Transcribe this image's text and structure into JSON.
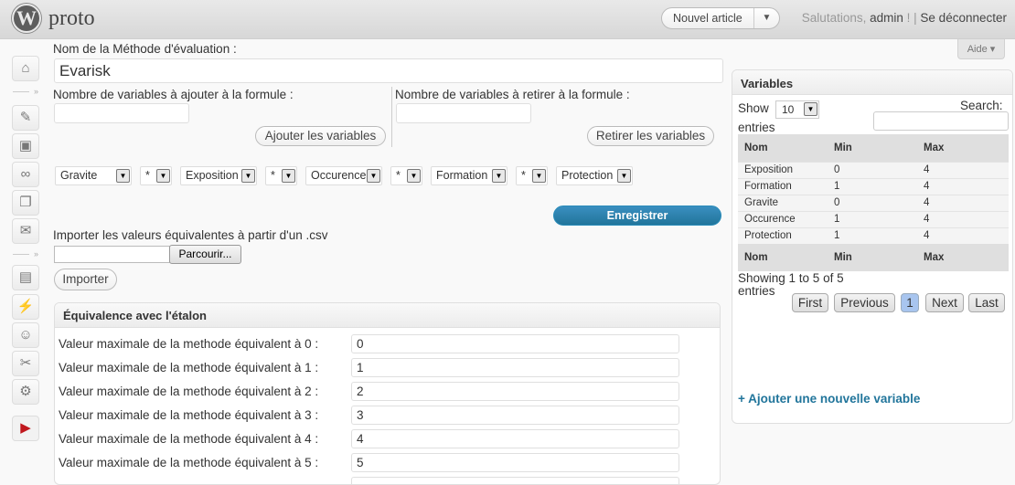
{
  "header": {
    "logo_letter": "W",
    "site_title": "proto",
    "favorite_action": "Nouvel article",
    "greeting_prefix": "Salutations,",
    "user": "admin",
    "greeting_suffix": " !",
    "separator": " | ",
    "logout": "Se déconnecter"
  },
  "help_tab": "Aide ▾",
  "form": {
    "method_name_label": "Nom de la Méthode d'évaluation :",
    "method_name_value": "Evarisk",
    "add_vars_label": "Nombre de variables à ajouter à la formule :",
    "remove_vars_label": "Nombre de variables à retirer à la formule :",
    "add_vars_button": "Ajouter les variables",
    "remove_vars_button": "Retirer les variables",
    "formula": [
      "Gravite",
      "*",
      "Exposition",
      "*",
      "Occurence",
      "*",
      "Formation",
      "*",
      "Protection"
    ],
    "save_button": "Enregistrer",
    "import_label": "Importer les valeurs équivalentes à partir d'un .csv",
    "browse_button": "Parcourir...",
    "import_button": "Importer"
  },
  "equivalence": {
    "title": "Équivalence avec l'étalon",
    "rows": [
      {
        "label": "Valeur maximale de la methode équivalent à 0 :",
        "value": "0"
      },
      {
        "label": "Valeur maximale de la methode équivalent à 1 :",
        "value": "1"
      },
      {
        "label": "Valeur maximale de la methode équivalent à 2 :",
        "value": "2"
      },
      {
        "label": "Valeur maximale de la methode équivalent à 3 :",
        "value": "3"
      },
      {
        "label": "Valeur maximale de la methode équivalent à 4 :",
        "value": "4"
      },
      {
        "label": "Valeur maximale de la methode équivalent à 5 :",
        "value": "5"
      }
    ]
  },
  "variables": {
    "title": "Variables",
    "show_label": "Show",
    "length_value": "10",
    "entries_label": "entries",
    "search_label": "Search:",
    "columns": [
      "Nom",
      "Min",
      "Max"
    ],
    "rows": [
      [
        "Exposition",
        "0",
        "4"
      ],
      [
        "Formation",
        "1",
        "4"
      ],
      [
        "Gravite",
        "0",
        "4"
      ],
      [
        "Occurence",
        "1",
        "4"
      ],
      [
        "Protection",
        "1",
        "4"
      ]
    ],
    "info_line1": "Showing 1 to 5 of 5",
    "info_line2": "entries",
    "pagination": {
      "first": "First",
      "previous": "Previous",
      "current": "1",
      "next": "Next",
      "last": "Last"
    },
    "add_link": "+ Ajouter une nouvelle variable"
  }
}
